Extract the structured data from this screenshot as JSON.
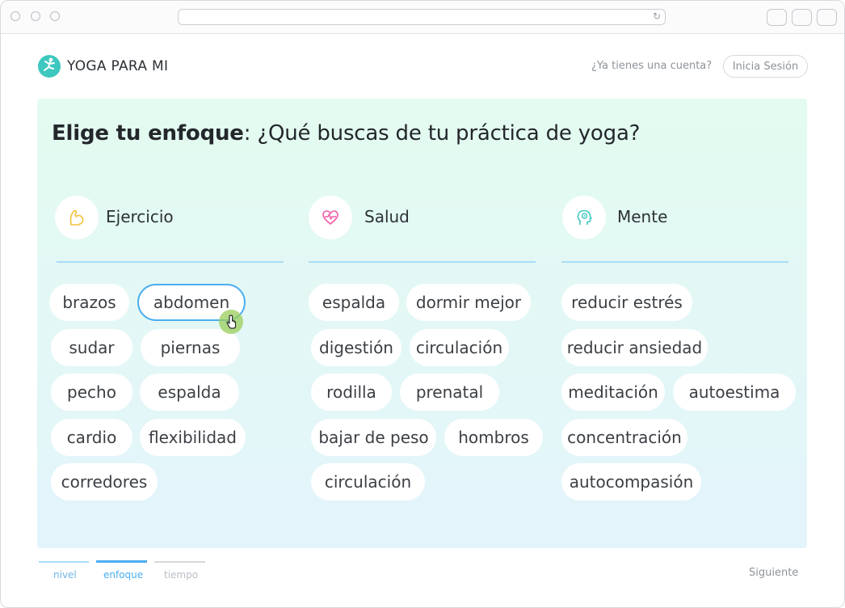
{
  "browser": {
    "reload_icon": "↻"
  },
  "header": {
    "brand": "YOGA PARA MI",
    "logo_icon": "yoga-pose-icon",
    "question": "¿Ya tienes una cuenta?",
    "login_label": "Inicia Sesión"
  },
  "main": {
    "heading_bold": "Elige tu enfoque",
    "heading_rest": ": ¿Qué buscas de tu práctica de yoga?",
    "categories": [
      {
        "label": "Ejercicio",
        "icon": "flexed-arm-icon",
        "color": "#f3c340",
        "chips": [
          "brazos",
          "abdomen",
          "sudar",
          "piernas",
          "pecho",
          "espalda",
          "cardio",
          "flexibilidad",
          "corredores"
        ]
      },
      {
        "label": "Salud",
        "icon": "heartbeat-icon",
        "color": "#ef5aa6",
        "chips": [
          "espalda",
          "dormir mejor",
          "digestión",
          "circulación",
          "rodilla",
          "prenatal",
          "bajar de peso",
          "hombros",
          "circulación"
        ]
      },
      {
        "label": "Mente",
        "icon": "head-mind-icon",
        "color": "#3ec7bf",
        "chips": [
          "reducir estrés",
          "reducir ansiedad",
          "meditación",
          "autoestima",
          "concentración",
          "autocompasión"
        ]
      }
    ],
    "selected_chip": "abdomen"
  },
  "footer": {
    "steps": [
      {
        "label": "nivel",
        "state": "done"
      },
      {
        "label": "enfoque",
        "state": "active"
      },
      {
        "label": "tiempo",
        "state": "pending"
      }
    ],
    "next_label": "Siguiente"
  },
  "colors": {
    "accent": "#4aaef0",
    "brand": "#3ec7bf",
    "panel_top": "#e3fbf0",
    "panel_bottom": "#e3f4fb"
  }
}
